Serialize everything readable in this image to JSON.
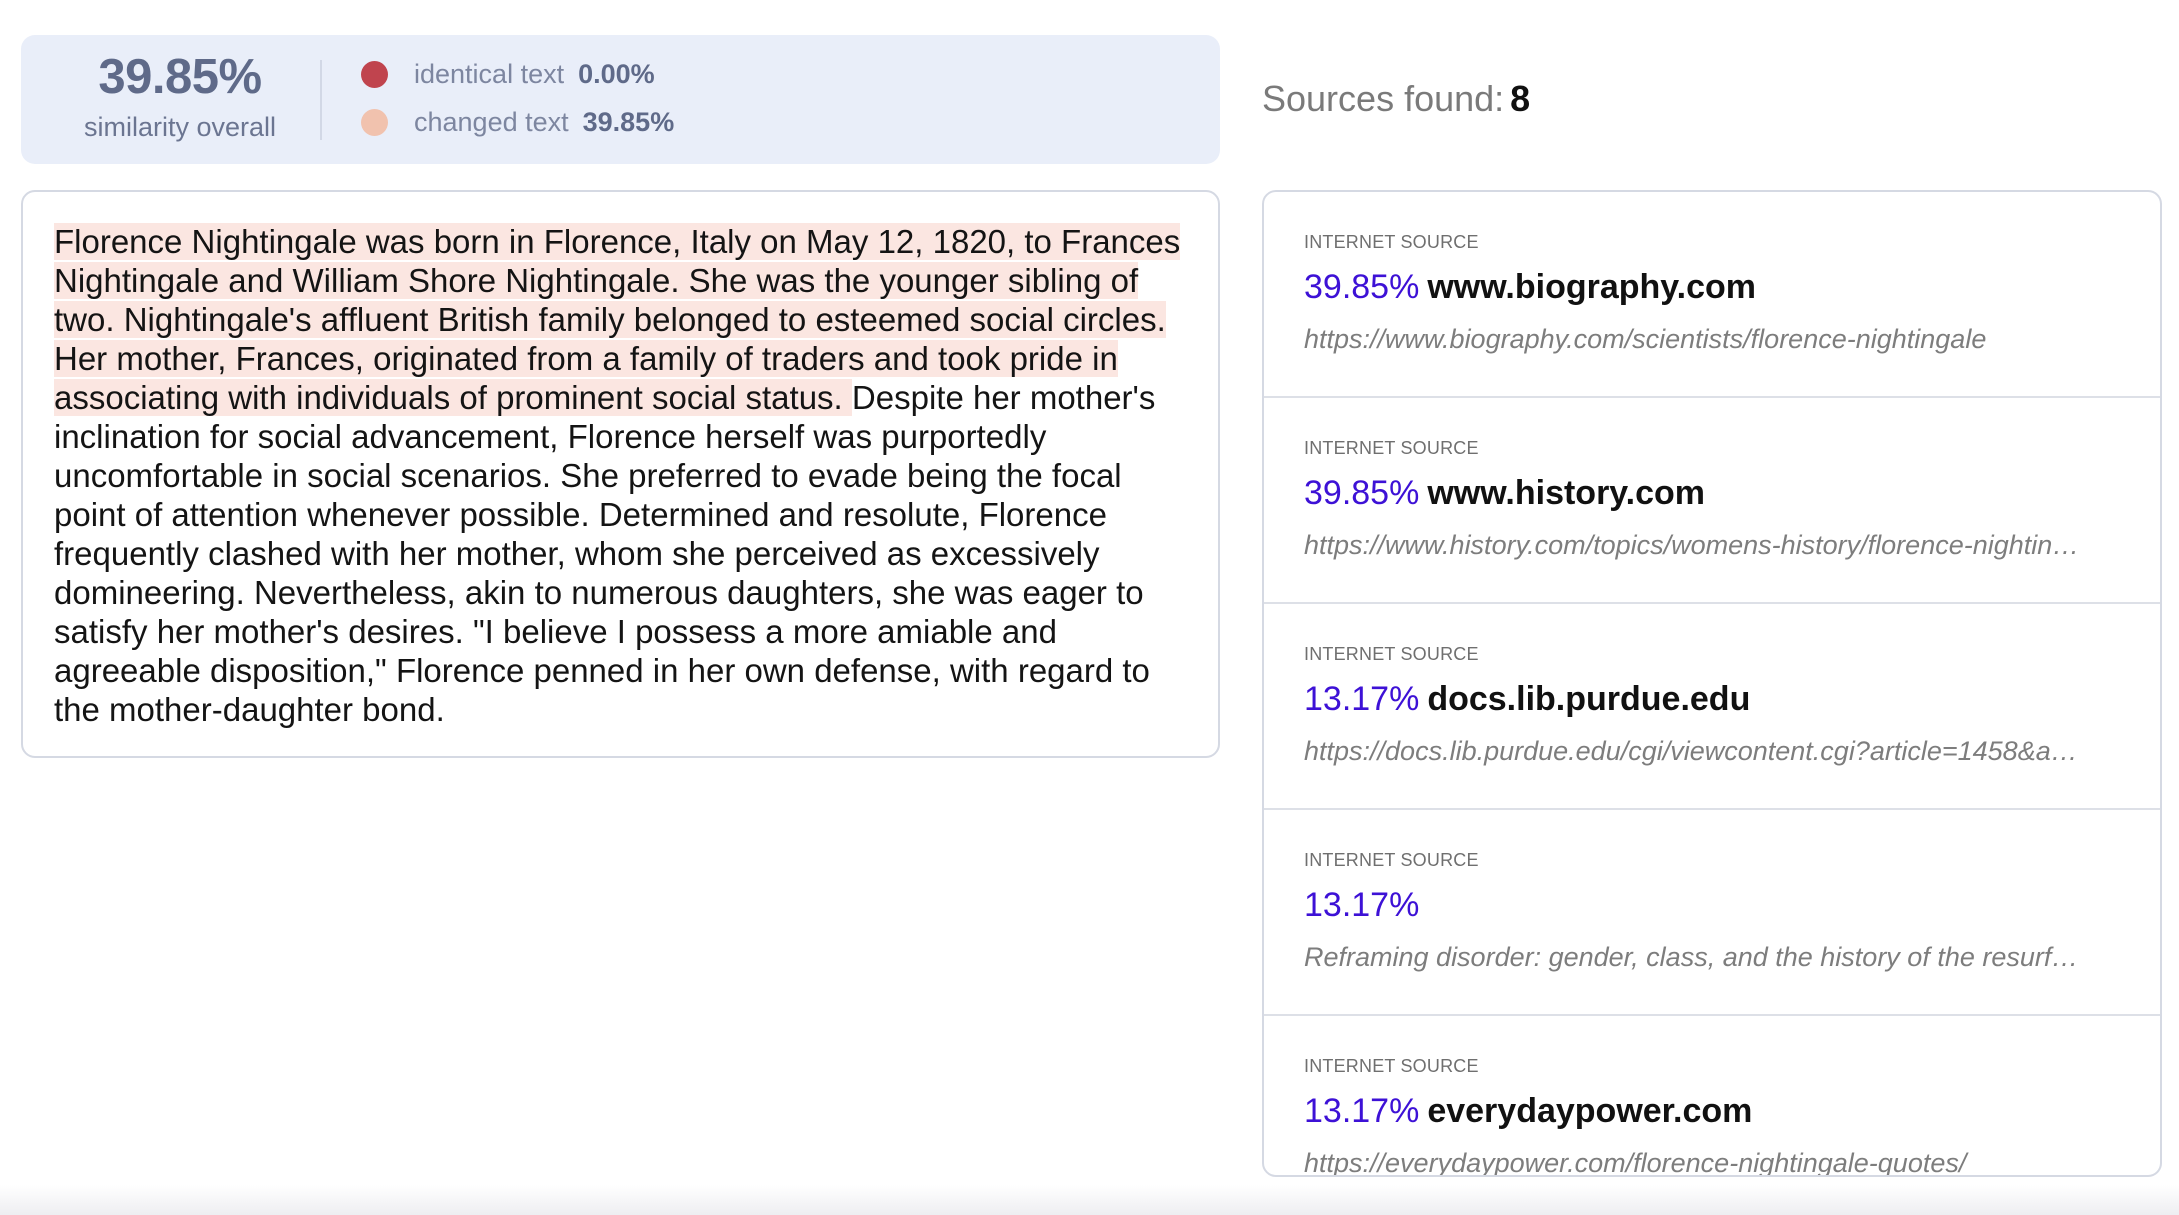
{
  "summary": {
    "overall_value": "39.85%",
    "overall_label": "similarity overall",
    "identical_label": "identical text",
    "identical_value": "0.00%",
    "identical_color": "#c0444e",
    "changed_label": "changed text",
    "changed_value": "39.85%",
    "changed_color": "#f1c2ae"
  },
  "sources_header": {
    "label": "Sources found:",
    "count": "8"
  },
  "document": {
    "highlighted_text": "Florence Nightingale was born in Florence, Italy on May 12, 1820, to Frances Nightingale and William Shore Nightingale. She was the younger sibling of two. Nightingale's affluent British family belonged to esteemed social circles. Her mother, Frances, originated from a family of traders and took pride in associating with individuals of prominent social status. ",
    "plain_text": "Despite her mother's inclination for social advancement, Florence herself was purportedly uncomfortable in social scenarios. She preferred to evade being the focal point of attention whenever possible. Determined and resolute, Florence frequently clashed with her mother, whom she perceived as excessively domineering. Nevertheless, akin to numerous daughters, she was eager to satisfy her mother's desires. \"I believe I possess a more amiable and agreeable disposition,\" Florence penned in her own defense, with regard to the mother-daughter bond."
  },
  "sources": [
    {
      "type": "INTERNET SOURCE",
      "percent": "39.85%",
      "domain": "www.biography.com",
      "url": "https://www.biography.com/scientists/florence-nightingale"
    },
    {
      "type": "INTERNET SOURCE",
      "percent": "39.85%",
      "domain": "www.history.com",
      "url": "https://www.history.com/topics/womens-history/florence-nightin…"
    },
    {
      "type": "INTERNET SOURCE",
      "percent": "13.17%",
      "domain": "docs.lib.purdue.edu",
      "url": "https://docs.lib.purdue.edu/cgi/viewcontent.cgi?article=1458&a…"
    },
    {
      "type": "INTERNET SOURCE",
      "percent": "13.17%",
      "domain": "",
      "url": "Reframing disorder: gender, class, and the history of the resurf…"
    },
    {
      "type": "INTERNET SOURCE",
      "percent": "13.17%",
      "domain": "everydaypower.com",
      "url": "https://everydaypower.com/florence-nightingale-quotes/"
    }
  ]
}
